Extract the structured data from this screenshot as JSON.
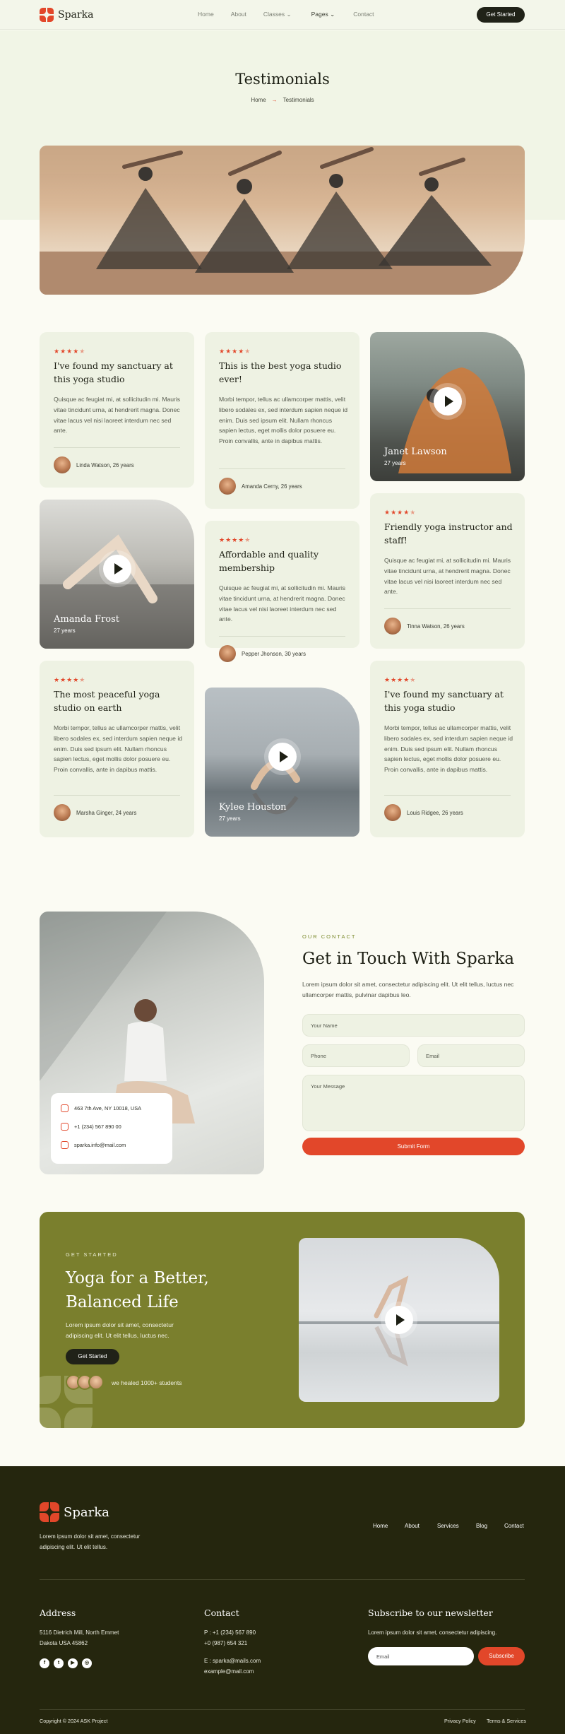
{
  "nav": {
    "brand": "Sparka",
    "items": [
      "Home",
      "About",
      "Classes",
      "Pages",
      "Contact"
    ],
    "cta": "Get Started"
  },
  "hero": {
    "title": "Testimonials",
    "breadcrumb_home": "Home",
    "breadcrumb_current": "Testimonials"
  },
  "testimonials": [
    {
      "title": "I've found my sanctuary at this yoga studio",
      "text": "Quisque ac feugiat mi, at sollicitudin mi. Mauris vitae tincidunt urna, at hendrerit magna. Donec vitae lacus vel nisi laoreet interdum nec sed ante.",
      "author": "Linda Watson, 26 years",
      "rating": 4.5
    },
    {
      "title": "This is the best yoga studio ever!",
      "text": "Morbi tempor, tellus ac ullamcorper mattis, velit libero sodales ex, sed interdum sapien neque id enim. Duis sed ipsum elit. Nullam rhoncus sapien lectus, eget mollis dolor posuere eu. Proin convallis, ante in dapibus mattis.",
      "author": "Amanda Cerny, 26 years",
      "rating": 4.5
    },
    {
      "title": "Friendly yoga instructor and staff!",
      "text": "Quisque ac feugiat mi, at sollicitudin mi. Mauris vitae tincidunt urna, at hendrerit magna. Donec vitae lacus vel nisi laoreet interdum nec sed ante.",
      "author": "Tinna Watson, 26 years",
      "rating": 4.5
    },
    {
      "title": "Affordable and quality membership",
      "text": "Quisque ac feugiat mi, at sollicitudin mi. Mauris vitae tincidunt urna, at hendrerit magna. Donec vitae lacus vel nisi laoreet interdum nec sed ante.",
      "author": "Pepper Jhonson, 30 years",
      "rating": 4.5
    },
    {
      "title": "The most peaceful yoga studio on earth",
      "text": "Morbi tempor, tellus ac ullamcorper mattis, velit libero sodales ex, sed interdum sapien neque id enim. Duis sed ipsum elit. Nullam rhoncus sapien lectus, eget mollis dolor posuere eu. Proin convallis, ante in dapibus mattis.",
      "author": "Marsha Ginger, 24 years",
      "rating": 4.5
    },
    {
      "title": "I've found my sanctuary at this yoga studio",
      "text": "Morbi tempor, tellus ac ullamcorper mattis, velit libero sodales ex, sed interdum sapien neque id enim. Duis sed ipsum elit. Nullam rhoncus sapien lectus, eget mollis dolor posuere eu. Proin convallis, ante in dapibus mattis.",
      "author": "Louis Ridgee, 26 years",
      "rating": 4.5
    }
  ],
  "videos": [
    {
      "name": "Janet Lawson",
      "age": "27 years"
    },
    {
      "name": "Amanda Frost",
      "age": "27 years"
    },
    {
      "name": "Kylee Houston",
      "age": "27 years"
    }
  ],
  "contact": {
    "eyebrow": "OUR CONTACT",
    "title": "Get in Touch With Sparka",
    "lead": "Lorem ipsum dolor sit amet, consectetur adipiscing elit. Ut elit tellus, luctus nec ullamcorper mattis, pulvinar dapibus leo.",
    "address": "463 7th Ave, NY 10018, USA",
    "phone": "+1 (234) 567 890 00",
    "email": "sparka.info@mail.com",
    "name_placeholder": "Your Name",
    "phone_placeholder": "Phone",
    "email_placeholder": "Email",
    "message_placeholder": "Your Message",
    "submit": "Submit Form"
  },
  "cta": {
    "eyebrow": "GET STARTED",
    "title_line1": "Yoga for a Better,",
    "title_line2": "Balanced Life",
    "text": "Lorem ipsum dolor sit amet, consectetur adipiscing elit. Ut elit tellus, luctus nec.",
    "button": "Get Started",
    "healed": "we healed 1000+ students"
  },
  "footer": {
    "brand": "Sparka",
    "about": "Lorem ipsum dolor sit amet, consectetur adipiscing elit. Ut elit tellus.",
    "links": [
      "Home",
      "About",
      "Services",
      "Blog",
      "Contact"
    ],
    "address_title": "Address",
    "address_line1": "5116 Dietrich Mill, North Emmet",
    "address_line2": "Dakota USA 45862",
    "contact_title": "Contact",
    "phone1": "P : +1 (234) 567 890",
    "phone2": "+0 (987) 654 321",
    "email1": "E : sparka@mails.com",
    "email2": "example@mail.com",
    "newsletter_title": "Subscribe to our newsletter",
    "newsletter_text": "Lorem ipsum dolor sit amet, consectetur adipiscing.",
    "email_placeholder": "Email",
    "subscribe": "Subscribe",
    "copyright": "Copyright © 2024 ASK Project",
    "privacy": "Privacy Policy",
    "terms": "Terms & Services"
  },
  "colors": {
    "accent": "#e2472a",
    "olive": "#7a7f2d",
    "dark": "#25260e",
    "card": "#eef2e3"
  }
}
